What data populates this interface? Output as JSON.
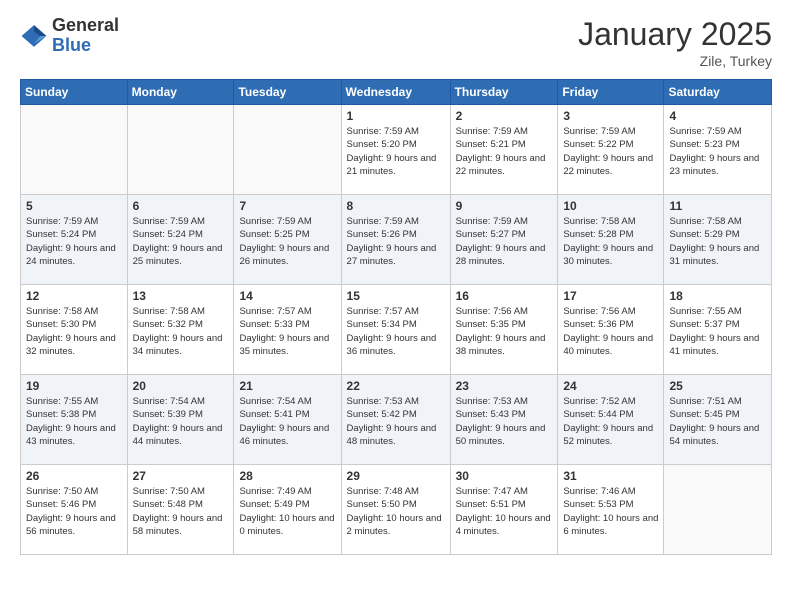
{
  "logo": {
    "general": "General",
    "blue": "Blue"
  },
  "header": {
    "month": "January 2025",
    "location": "Zile, Turkey"
  },
  "columns": [
    "Sunday",
    "Monday",
    "Tuesday",
    "Wednesday",
    "Thursday",
    "Friday",
    "Saturday"
  ],
  "weeks": [
    [
      {
        "day": "",
        "info": ""
      },
      {
        "day": "",
        "info": ""
      },
      {
        "day": "",
        "info": ""
      },
      {
        "day": "1",
        "info": "Sunrise: 7:59 AM\nSunset: 5:20 PM\nDaylight: 9 hours\nand 21 minutes."
      },
      {
        "day": "2",
        "info": "Sunrise: 7:59 AM\nSunset: 5:21 PM\nDaylight: 9 hours\nand 22 minutes."
      },
      {
        "day": "3",
        "info": "Sunrise: 7:59 AM\nSunset: 5:22 PM\nDaylight: 9 hours\nand 22 minutes."
      },
      {
        "day": "4",
        "info": "Sunrise: 7:59 AM\nSunset: 5:23 PM\nDaylight: 9 hours\nand 23 minutes."
      }
    ],
    [
      {
        "day": "5",
        "info": "Sunrise: 7:59 AM\nSunset: 5:24 PM\nDaylight: 9 hours\nand 24 minutes."
      },
      {
        "day": "6",
        "info": "Sunrise: 7:59 AM\nSunset: 5:24 PM\nDaylight: 9 hours\nand 25 minutes."
      },
      {
        "day": "7",
        "info": "Sunrise: 7:59 AM\nSunset: 5:25 PM\nDaylight: 9 hours\nand 26 minutes."
      },
      {
        "day": "8",
        "info": "Sunrise: 7:59 AM\nSunset: 5:26 PM\nDaylight: 9 hours\nand 27 minutes."
      },
      {
        "day": "9",
        "info": "Sunrise: 7:59 AM\nSunset: 5:27 PM\nDaylight: 9 hours\nand 28 minutes."
      },
      {
        "day": "10",
        "info": "Sunrise: 7:58 AM\nSunset: 5:28 PM\nDaylight: 9 hours\nand 30 minutes."
      },
      {
        "day": "11",
        "info": "Sunrise: 7:58 AM\nSunset: 5:29 PM\nDaylight: 9 hours\nand 31 minutes."
      }
    ],
    [
      {
        "day": "12",
        "info": "Sunrise: 7:58 AM\nSunset: 5:30 PM\nDaylight: 9 hours\nand 32 minutes."
      },
      {
        "day": "13",
        "info": "Sunrise: 7:58 AM\nSunset: 5:32 PM\nDaylight: 9 hours\nand 34 minutes."
      },
      {
        "day": "14",
        "info": "Sunrise: 7:57 AM\nSunset: 5:33 PM\nDaylight: 9 hours\nand 35 minutes."
      },
      {
        "day": "15",
        "info": "Sunrise: 7:57 AM\nSunset: 5:34 PM\nDaylight: 9 hours\nand 36 minutes."
      },
      {
        "day": "16",
        "info": "Sunrise: 7:56 AM\nSunset: 5:35 PM\nDaylight: 9 hours\nand 38 minutes."
      },
      {
        "day": "17",
        "info": "Sunrise: 7:56 AM\nSunset: 5:36 PM\nDaylight: 9 hours\nand 40 minutes."
      },
      {
        "day": "18",
        "info": "Sunrise: 7:55 AM\nSunset: 5:37 PM\nDaylight: 9 hours\nand 41 minutes."
      }
    ],
    [
      {
        "day": "19",
        "info": "Sunrise: 7:55 AM\nSunset: 5:38 PM\nDaylight: 9 hours\nand 43 minutes."
      },
      {
        "day": "20",
        "info": "Sunrise: 7:54 AM\nSunset: 5:39 PM\nDaylight: 9 hours\nand 44 minutes."
      },
      {
        "day": "21",
        "info": "Sunrise: 7:54 AM\nSunset: 5:41 PM\nDaylight: 9 hours\nand 46 minutes."
      },
      {
        "day": "22",
        "info": "Sunrise: 7:53 AM\nSunset: 5:42 PM\nDaylight: 9 hours\nand 48 minutes."
      },
      {
        "day": "23",
        "info": "Sunrise: 7:53 AM\nSunset: 5:43 PM\nDaylight: 9 hours\nand 50 minutes."
      },
      {
        "day": "24",
        "info": "Sunrise: 7:52 AM\nSunset: 5:44 PM\nDaylight: 9 hours\nand 52 minutes."
      },
      {
        "day": "25",
        "info": "Sunrise: 7:51 AM\nSunset: 5:45 PM\nDaylight: 9 hours\nand 54 minutes."
      }
    ],
    [
      {
        "day": "26",
        "info": "Sunrise: 7:50 AM\nSunset: 5:46 PM\nDaylight: 9 hours\nand 56 minutes."
      },
      {
        "day": "27",
        "info": "Sunrise: 7:50 AM\nSunset: 5:48 PM\nDaylight: 9 hours\nand 58 minutes."
      },
      {
        "day": "28",
        "info": "Sunrise: 7:49 AM\nSunset: 5:49 PM\nDaylight: 10 hours\nand 0 minutes."
      },
      {
        "day": "29",
        "info": "Sunrise: 7:48 AM\nSunset: 5:50 PM\nDaylight: 10 hours\nand 2 minutes."
      },
      {
        "day": "30",
        "info": "Sunrise: 7:47 AM\nSunset: 5:51 PM\nDaylight: 10 hours\nand 4 minutes."
      },
      {
        "day": "31",
        "info": "Sunrise: 7:46 AM\nSunset: 5:53 PM\nDaylight: 10 hours\nand 6 minutes."
      },
      {
        "day": "",
        "info": ""
      }
    ]
  ]
}
